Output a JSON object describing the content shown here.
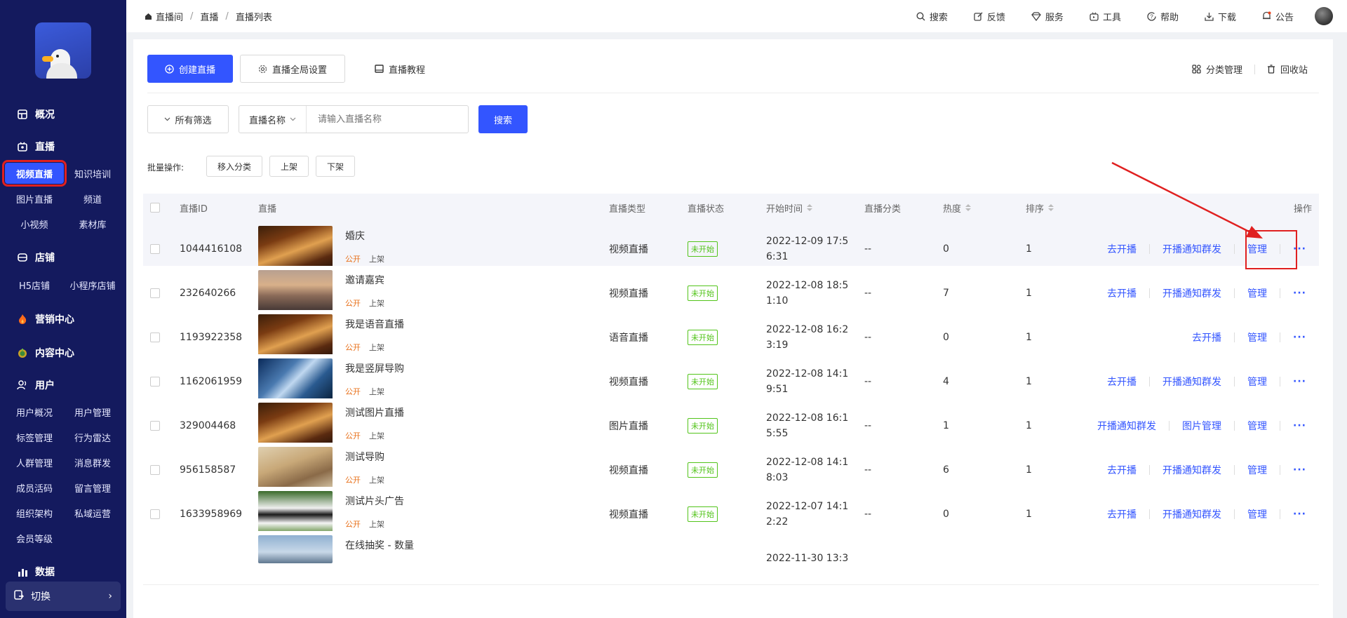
{
  "sidebar": {
    "sections": [
      {
        "label": "概况",
        "icon": "overview-icon"
      },
      {
        "label": "直播",
        "icon": "live-icon"
      },
      {
        "label": "店铺",
        "icon": "store-icon"
      },
      {
        "label": "营销中心",
        "icon": "flame-icon"
      },
      {
        "label": "内容中心",
        "icon": "content-icon"
      },
      {
        "label": "用户",
        "icon": "users-icon"
      },
      {
        "label": "数据",
        "icon": "chart-icon"
      }
    ],
    "live_items": [
      "视频直播",
      "知识培训",
      "图片直播",
      "频道",
      "小视频",
      "素材库"
    ],
    "store_items": [
      "H5店铺",
      "小程序店铺"
    ],
    "user_items": [
      "用户概况",
      "用户管理",
      "标签管理",
      "行为雷达",
      "人群管理",
      "消息群发",
      "成员活码",
      "留言管理",
      "组织架构",
      "私域运营",
      "会员等级"
    ],
    "switch_label": "切换"
  },
  "breadcrumb": [
    "直播间",
    "直播",
    "直播列表"
  ],
  "topbar": [
    "搜索",
    "反馈",
    "服务",
    "工具",
    "帮助",
    "下载",
    "公告"
  ],
  "toolbar": {
    "create": "创建直播",
    "global_settings": "直播全局设置",
    "tutorial": "直播教程",
    "category_mgmt": "分类管理",
    "recycle": "回收站"
  },
  "filter": {
    "all_filters": "所有筛选",
    "field": "直播名称",
    "placeholder": "请输入直播名称",
    "search": "搜索"
  },
  "batch": {
    "label": "批量操作:",
    "move": "移入分类",
    "on": "上架",
    "off": "下架"
  },
  "table": {
    "headers": [
      "直播ID",
      "直播",
      "直播类型",
      "直播状态",
      "开始时间",
      "直播分类",
      "热度",
      "排序",
      "操作"
    ],
    "rows": [
      {
        "id": "1044416108",
        "title": "婚庆",
        "pub": "公开",
        "shelf": "上架",
        "type": "视频直播",
        "status": "未开始",
        "time1": "2022-12-09 17:5",
        "time2": "6:31",
        "category": "--",
        "heat": "0",
        "order": "1",
        "ops": [
          "去开播",
          "开播通知群发",
          "管理"
        ],
        "thumb": "restaurant"
      },
      {
        "id": "232640266",
        "title": "邀请嘉宾",
        "pub": "公开",
        "shelf": "上架",
        "type": "视频直播",
        "status": "未开始",
        "time1": "2022-12-08 18:5",
        "time2": "1:10",
        "category": "--",
        "heat": "7",
        "order": "1",
        "ops": [
          "去开播",
          "开播通知群发",
          "管理"
        ],
        "thumb": "city"
      },
      {
        "id": "1193922358",
        "title": "我是语音直播",
        "pub": "公开",
        "shelf": "上架",
        "type": "语音直播",
        "status": "未开始",
        "time1": "2022-12-08 16:2",
        "time2": "3:19",
        "category": "--",
        "heat": "0",
        "order": "1",
        "ops": [
          "去开播",
          "管理"
        ],
        "thumb": "restaurant"
      },
      {
        "id": "1162061959",
        "title": "我是竖屏导购",
        "pub": "公开",
        "shelf": "上架",
        "type": "视频直播",
        "status": "未开始",
        "time1": "2022-12-08 14:1",
        "time2": "9:51",
        "category": "--",
        "heat": "4",
        "order": "1",
        "ops": [
          "去开播",
          "开播通知群发",
          "管理"
        ],
        "thumb": "building"
      },
      {
        "id": "329004468",
        "title": "测试图片直播",
        "pub": "公开",
        "shelf": "上架",
        "type": "图片直播",
        "status": "未开始",
        "time1": "2022-12-08 16:1",
        "time2": "5:55",
        "category": "--",
        "heat": "1",
        "order": "1",
        "ops": [
          "开播通知群发",
          "图片管理",
          "管理"
        ],
        "thumb": "restaurant"
      },
      {
        "id": "956158587",
        "title": "测试导购",
        "pub": "公开",
        "shelf": "上架",
        "type": "视频直播",
        "status": "未开始",
        "time1": "2022-12-08 14:1",
        "time2": "8:03",
        "category": "--",
        "heat": "6",
        "order": "1",
        "ops": [
          "去开播",
          "开播通知群发",
          "管理"
        ],
        "thumb": "dog"
      },
      {
        "id": "1633958969",
        "title": "测试片头广告",
        "pub": "公开",
        "shelf": "上架",
        "type": "视频直播",
        "status": "未开始",
        "time1": "2022-12-07 14:1",
        "time2": "2:22",
        "category": "--",
        "heat": "0",
        "order": "1",
        "ops": [
          "去开播",
          "开播通知群发",
          "管理"
        ],
        "thumb": "panda"
      },
      {
        "id": "",
        "title": "在线抽奖 - 数量",
        "pub": "",
        "shelf": "",
        "type": "",
        "status": "",
        "time1": "2022-11-30 13:3",
        "time2": "",
        "category": "",
        "heat": "",
        "order": "",
        "ops": [],
        "thumb": "bridge"
      }
    ]
  }
}
